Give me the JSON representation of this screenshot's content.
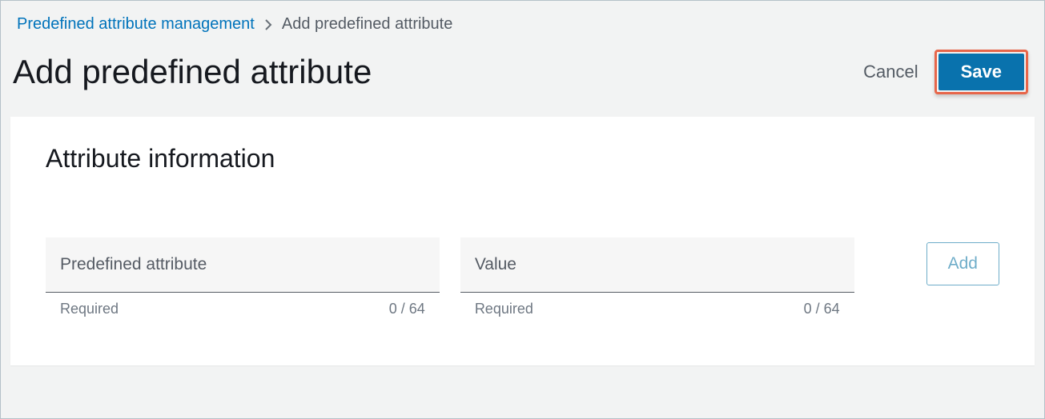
{
  "breadcrumb": {
    "parent": "Predefined attribute management",
    "current": "Add predefined attribute"
  },
  "header": {
    "title": "Add predefined attribute",
    "cancel_label": "Cancel",
    "save_label": "Save"
  },
  "panel": {
    "title": "Attribute information",
    "fields": {
      "attribute": {
        "placeholder": "Predefined attribute",
        "required_label": "Required",
        "counter": "0 / 64"
      },
      "value": {
        "placeholder": "Value",
        "required_label": "Required",
        "counter": "0 / 64"
      }
    },
    "add_label": "Add"
  }
}
